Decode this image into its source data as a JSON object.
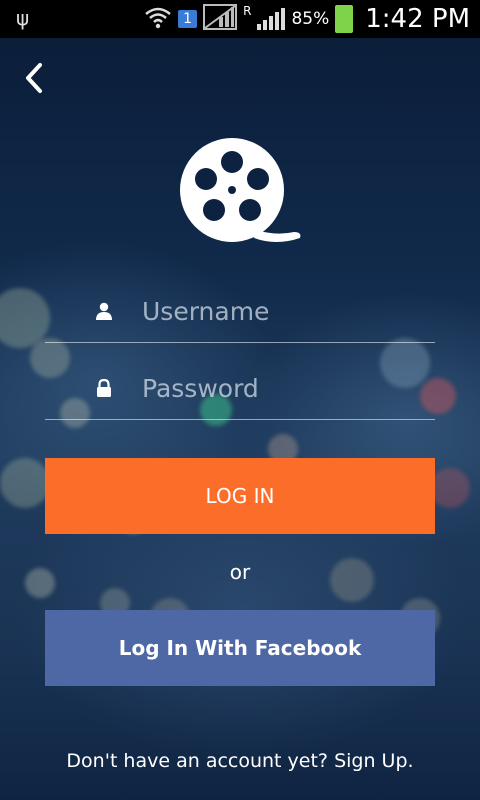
{
  "status_bar": {
    "sim_slot": "1",
    "roaming": "R",
    "battery": "85%",
    "time": "1:42 PM"
  },
  "nav": {
    "back_icon": "chevron-left-icon"
  },
  "logo": {
    "icon": "film-reel-icon"
  },
  "form": {
    "username": {
      "icon": "user-icon",
      "placeholder": "Username",
      "value": ""
    },
    "password": {
      "icon": "lock-icon",
      "placeholder": "Password",
      "value": ""
    }
  },
  "actions": {
    "login_label": "LOG IN",
    "or_label": "or",
    "facebook_label": "Log In With Facebook",
    "signup_prompt": "Don't have an account yet?",
    "signup_link": "Sign Up."
  },
  "colors": {
    "login_button": "#fd6d2a",
    "facebook_button": "#4e67a5",
    "background": "#0d2240"
  }
}
